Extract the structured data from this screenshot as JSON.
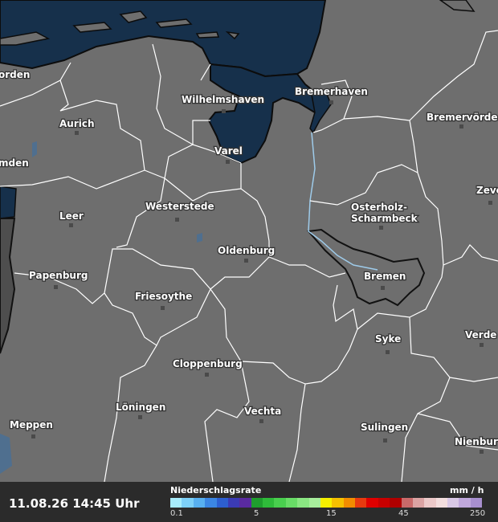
{
  "map": {
    "cities": [
      {
        "name": "Norden",
        "label": "orden"
      },
      {
        "name": "Emden",
        "label": "mden"
      },
      {
        "name": "Aurich",
        "label": "Aurich"
      },
      {
        "name": "Wilhelmshaven",
        "label": "Wilhelmshaven"
      },
      {
        "name": "Bremerhaven",
        "label": "Bremerhaven"
      },
      {
        "name": "Bremervörde",
        "label": "Bremervörde"
      },
      {
        "name": "Varel",
        "label": "Varel"
      },
      {
        "name": "Zeven",
        "label": "Zeve"
      },
      {
        "name": "Leer",
        "label": "Leer"
      },
      {
        "name": "Westerstede",
        "label": "Westerstede"
      },
      {
        "name": "Osterholz-Scharmbeck",
        "label": "Osterholz-\nScharmbeck"
      },
      {
        "name": "Oldenburg",
        "label": "Oldenburg"
      },
      {
        "name": "Papenburg",
        "label": "Papenburg"
      },
      {
        "name": "Bremen",
        "label": "Bremen"
      },
      {
        "name": "Friesoythe",
        "label": "Friesoythe"
      },
      {
        "name": "Verden",
        "label": "Verde"
      },
      {
        "name": "Syke",
        "label": "Syke"
      },
      {
        "name": "Cloppenburg",
        "label": "Cloppenburg"
      },
      {
        "name": "Löningen",
        "label": "Löningen"
      },
      {
        "name": "Vechta",
        "label": "Vechta"
      },
      {
        "name": "Meppen",
        "label": "Meppen"
      },
      {
        "name": "Sulingen",
        "label": "Sulingen"
      },
      {
        "name": "Nienburg",
        "label": "Nienbur"
      }
    ],
    "colors": {
      "land": "#6e6e6e",
      "sea": "#16304b",
      "border": "#ffffff",
      "state_border": "#111111"
    }
  },
  "legend": {
    "timestamp": "11.08.26 14:45 Uhr",
    "title": "Niederschlagsrate",
    "unit": "mm / h",
    "ticks": [
      "0.1",
      "5",
      "15",
      "45",
      "250"
    ],
    "colors": [
      "#a8ecfc",
      "#7dd0f8",
      "#58b0f0",
      "#3b86e3",
      "#2d5fd0",
      "#3b3bb5",
      "#5a2aa0",
      "#1f9e2e",
      "#2fbb3a",
      "#49cf4e",
      "#68dc66",
      "#8ae682",
      "#a8ee9c",
      "#f5f000",
      "#f5c000",
      "#f28c00",
      "#e83a0f",
      "#e00000",
      "#c80000",
      "#b00000",
      "#c96a6a",
      "#dba3a3",
      "#ecc9c9",
      "#f3dede",
      "#d9c8e6",
      "#c0a8dc",
      "#a88fcf"
    ]
  }
}
